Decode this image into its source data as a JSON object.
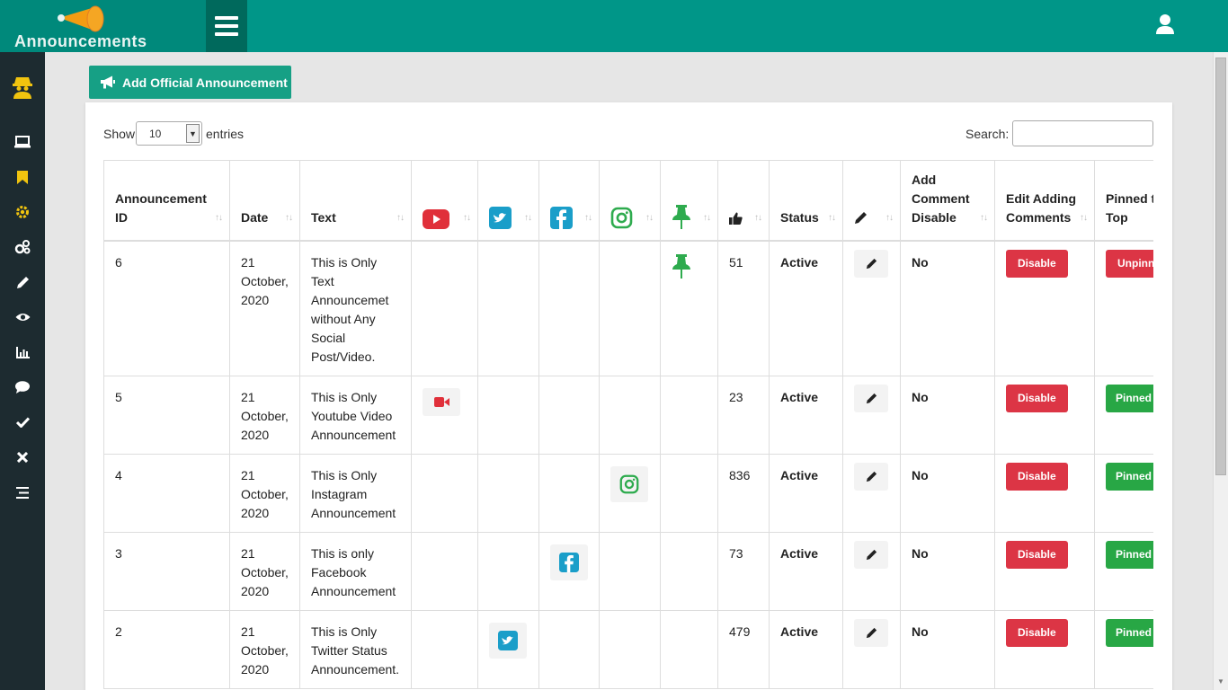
{
  "app": {
    "logo_text": "Announcements"
  },
  "toolbar": {
    "add_label": "Add Official Announcement"
  },
  "table_controls": {
    "show_label": "Show",
    "entries_value": "10",
    "entries_label": "entries",
    "search_label": "Search:",
    "search_value": ""
  },
  "columns": {
    "id": "Announcement ID",
    "date": "Date",
    "text": "Text",
    "youtube": "youtube-icon",
    "twitter": "twitter-icon",
    "facebook": "facebook-icon",
    "instagram": "instagram-icon",
    "pin": "pin-icon",
    "likes": "thumbs-up-icon",
    "status": "Status",
    "edit": "pencil-icon",
    "add_comment_disable": "Add Comment Disable",
    "edit_adding_comments": "Edit Adding Comments",
    "pinned_to_top": "Pinned to Top"
  },
  "rows": [
    {
      "id": "6",
      "date": "21 October, 2020",
      "text": "This is Only Text Announcemet without Any Social Post/Video.",
      "social": "pin",
      "likes": "51",
      "status": "Active",
      "add_comment_disable": "No",
      "edit_comments_btn": "Disable",
      "pinned_btn": "Unpinned",
      "pinned_color": "red"
    },
    {
      "id": "5",
      "date": "21 October, 2020",
      "text": "This is Only Youtube Video Announcement",
      "social": "youtube",
      "likes": "23",
      "status": "Active",
      "add_comment_disable": "No",
      "edit_comments_btn": "Disable",
      "pinned_btn": "Pinned",
      "pinned_color": "green"
    },
    {
      "id": "4",
      "date": "21 October, 2020",
      "text": "This is Only Instagram Announcement",
      "social": "instagram",
      "likes": "836",
      "status": "Active",
      "add_comment_disable": "No",
      "edit_comments_btn": "Disable",
      "pinned_btn": "Pinned",
      "pinned_color": "green"
    },
    {
      "id": "3",
      "date": "21 October, 2020",
      "text": "This is only Facebook Announcement",
      "social": "facebook",
      "likes": "73",
      "status": "Active",
      "add_comment_disable": "No",
      "edit_comments_btn": "Disable",
      "pinned_btn": "Pinned",
      "pinned_color": "green"
    },
    {
      "id": "2",
      "date": "21 October, 2020",
      "text": "This is Only Twitter Status Announcement.",
      "social": "twitter",
      "likes": "479",
      "status": "Active",
      "add_comment_disable": "No",
      "edit_comments_btn": "Disable",
      "pinned_btn": "Pinned",
      "pinned_color": "green"
    }
  ],
  "sidebar": {
    "items": [
      "spy-avatar-icon",
      "laptop-icon",
      "bookmark-icon",
      "gear-icon",
      "cogs-icon",
      "pencil-icon",
      "eye-icon",
      "bar-chart-icon",
      "comment-icon",
      "check-icon",
      "close-icon",
      "list-icon"
    ]
  },
  "colors": {
    "topbar": "#009688",
    "sidebar": "#1d2b30",
    "accent": "#16a085",
    "danger": "#dc3545",
    "success": "#28a745",
    "youtube": "#e0303a",
    "social_blue": "#1a9ec9",
    "pin_green": "#2eab4e"
  }
}
